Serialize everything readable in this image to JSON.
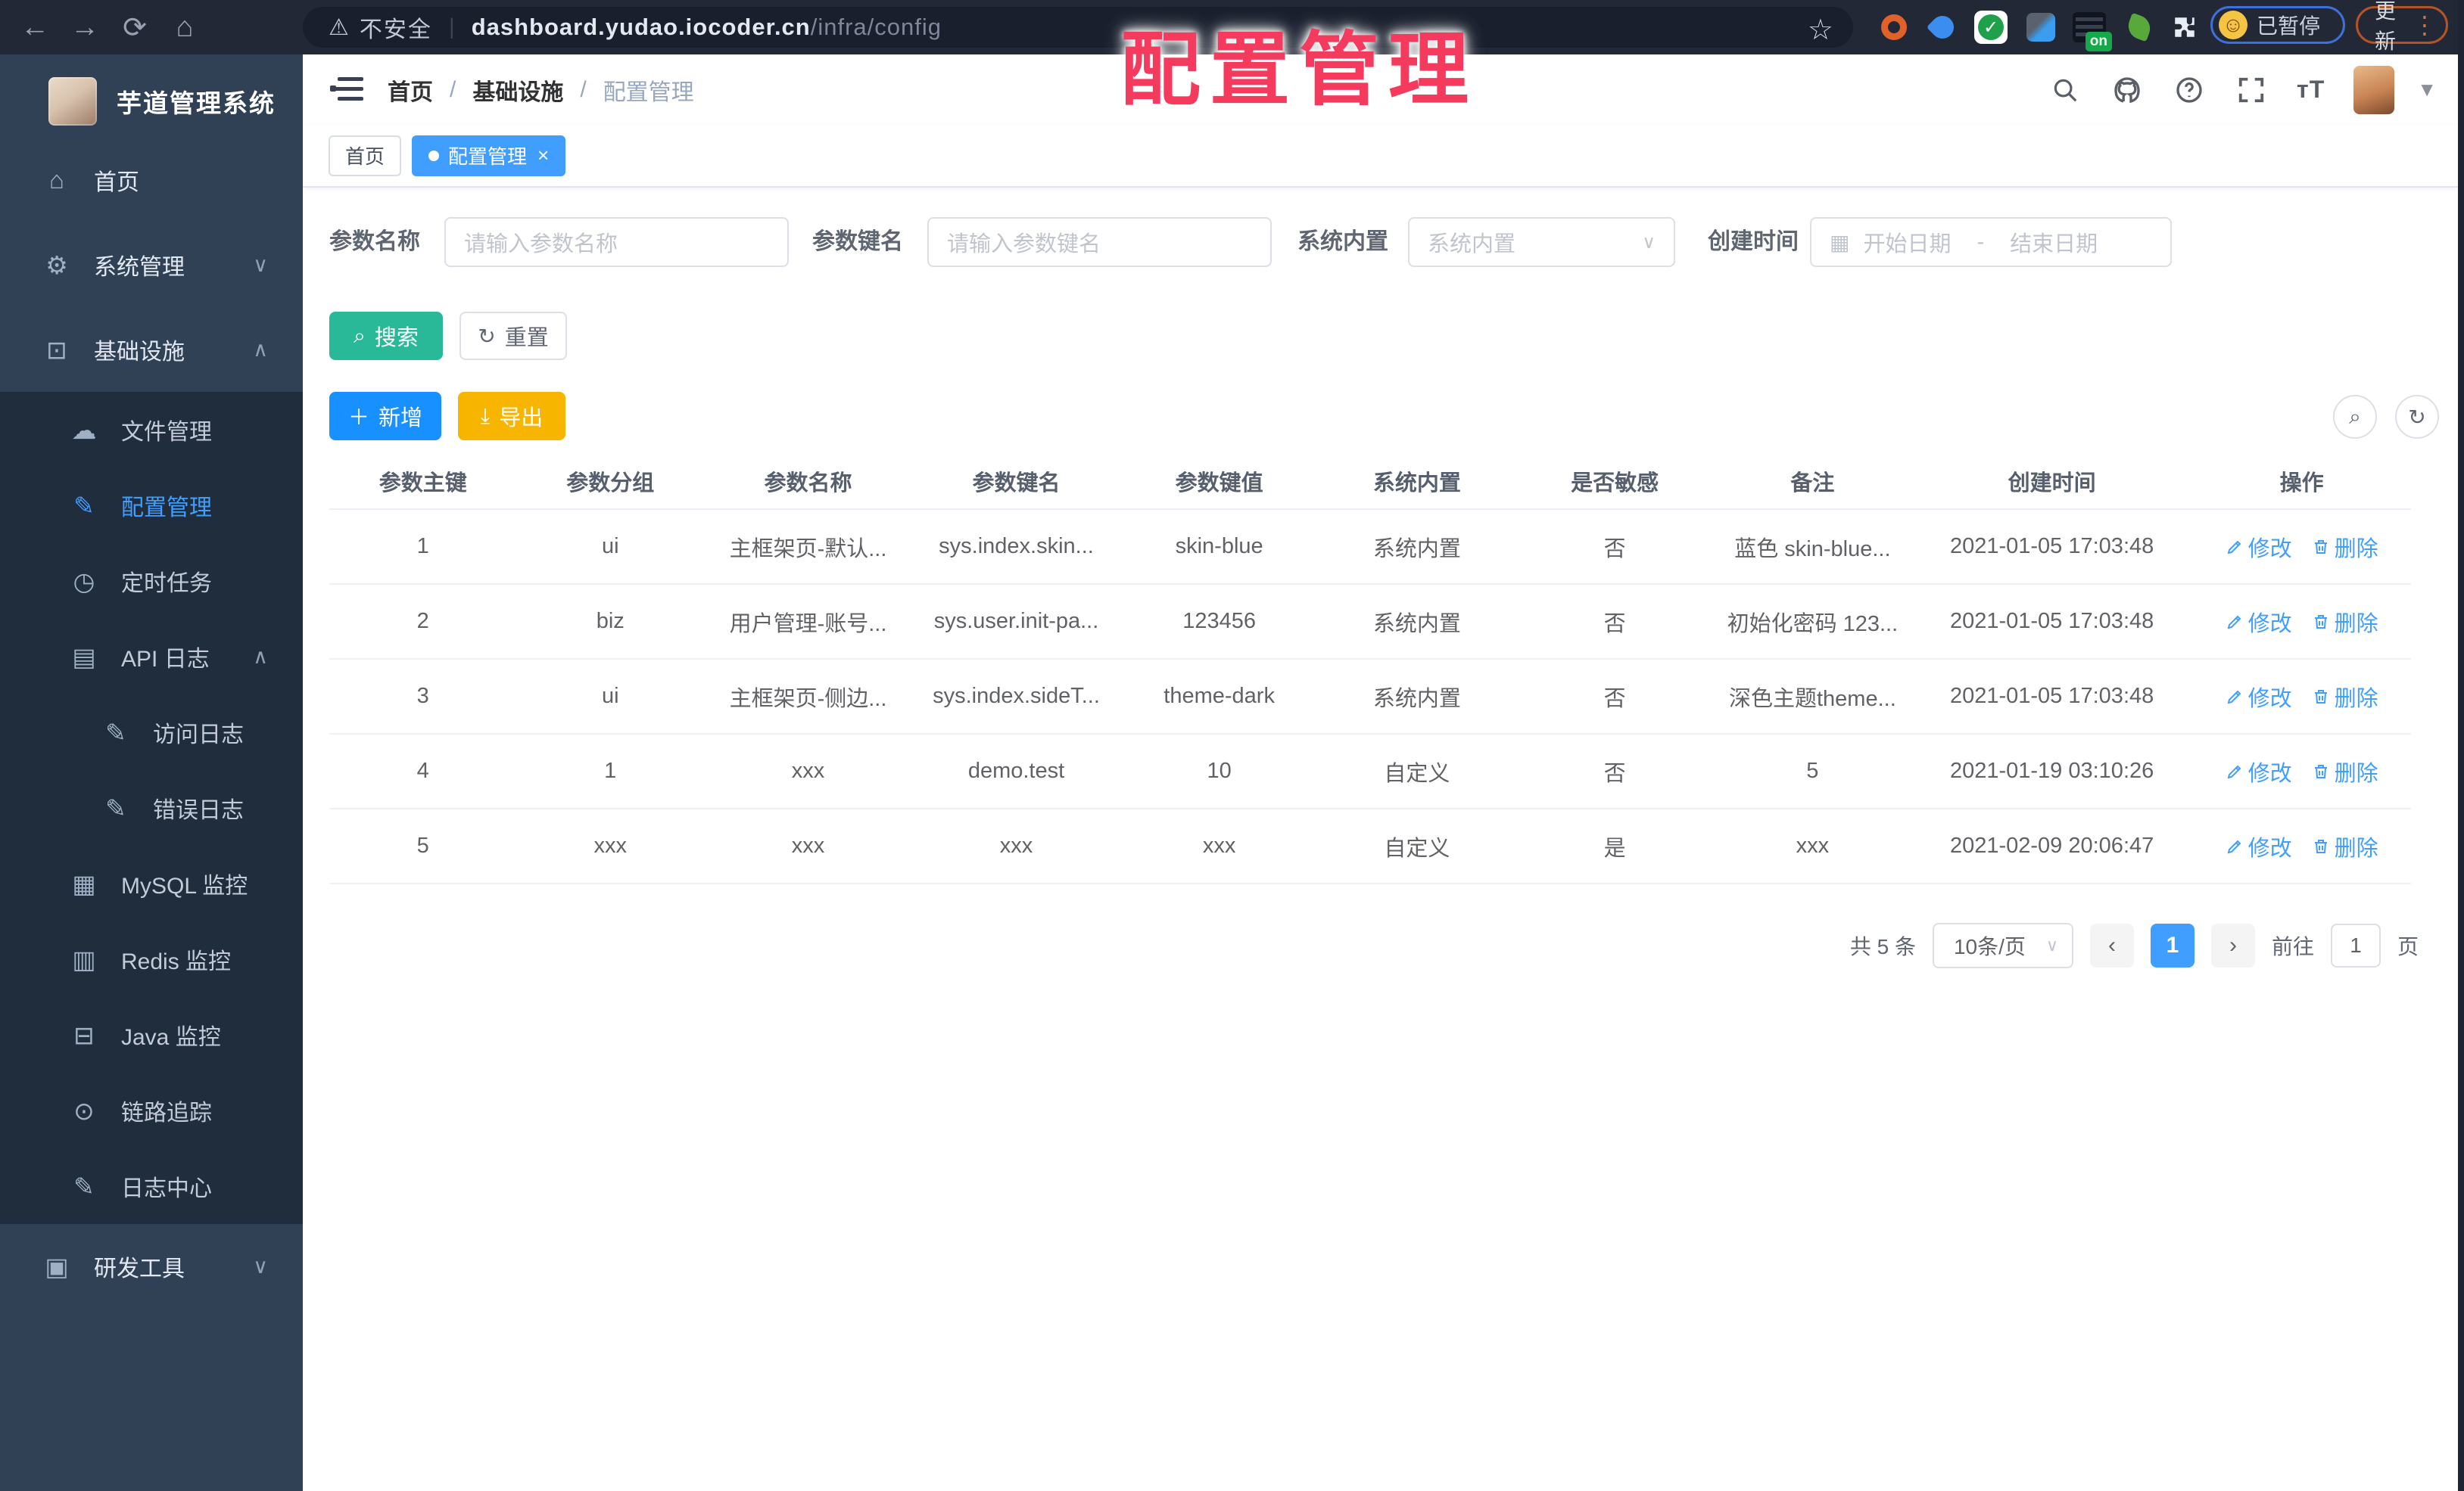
{
  "browser": {
    "security_label": "不安全",
    "url_host": "dashboard.yudao.iocoder.cn",
    "url_path": "/infra/config",
    "on_badge": "on",
    "paused_badge": "已暂停",
    "update_button": "更新"
  },
  "watermark": "配置管理",
  "sidebar": {
    "app_title": "芋道管理系统",
    "items": [
      {
        "id": "home",
        "label": "首页",
        "icon": "home-icon",
        "depth": 0
      },
      {
        "id": "system-mgmt",
        "label": "系统管理",
        "icon": "gear-icon",
        "depth": 0,
        "chevron": "down"
      },
      {
        "id": "infrastructure",
        "label": "基础设施",
        "icon": "infra-icon",
        "depth": 0,
        "chevron": "up"
      },
      {
        "id": "file-mgmt",
        "label": "文件管理",
        "icon": "cloud-upload-icon",
        "depth": 1
      },
      {
        "id": "config-mgmt",
        "label": "配置管理",
        "icon": "edit-square-icon",
        "depth": 1,
        "active": true
      },
      {
        "id": "scheduled-jobs",
        "label": "定时任务",
        "icon": "timer-icon",
        "depth": 1
      },
      {
        "id": "api-log",
        "label": "API 日志",
        "icon": "api-log-icon",
        "depth": 1,
        "chevron": "up"
      },
      {
        "id": "access-log",
        "label": "访问日志",
        "icon": "access-log-icon",
        "depth": 2
      },
      {
        "id": "error-log",
        "label": "错误日志",
        "icon": "error-log-icon",
        "depth": 2
      },
      {
        "id": "mysql-monitor",
        "label": "MySQL 监控",
        "icon": "mysql-icon",
        "depth": 1
      },
      {
        "id": "redis-monitor",
        "label": "Redis 监控",
        "icon": "redis-icon",
        "depth": 1
      },
      {
        "id": "java-monitor",
        "label": "Java 监控",
        "icon": "java-icon",
        "depth": 1
      },
      {
        "id": "trace",
        "label": "链路追踪",
        "icon": "eye-icon",
        "depth": 1
      },
      {
        "id": "log-center",
        "label": "日志中心",
        "icon": "log-center-icon",
        "depth": 1
      },
      {
        "id": "dev-tools",
        "label": "研发工具",
        "icon": "toolbox-icon",
        "depth": 0,
        "chevron": "down"
      }
    ]
  },
  "header": {
    "breadcrumb": [
      "首页",
      "基础设施",
      "配置管理"
    ]
  },
  "tabs": [
    {
      "label": "首页",
      "active": false
    },
    {
      "label": "配置管理",
      "active": true
    }
  ],
  "filters": {
    "name_label": "参数名称",
    "name_placeholder": "请输入参数名称",
    "key_label": "参数键名",
    "key_placeholder": "请输入参数键名",
    "type_label": "系统内置",
    "type_placeholder": "系统内置",
    "date_label": "创建时间",
    "date_start_placeholder": "开始日期",
    "date_separator": "-",
    "date_end_placeholder": "结束日期"
  },
  "toolbar": {
    "search_label": "搜索",
    "reset_label": "重置",
    "add_label": "新增",
    "export_label": "导出"
  },
  "table": {
    "columns": [
      "参数主键",
      "参数分组",
      "参数名称",
      "参数键名",
      "参数键值",
      "系统内置",
      "是否敏感",
      "备注",
      "创建时间",
      "操作"
    ],
    "rows": [
      [
        "1",
        "ui",
        "主框架页-默认...",
        "sys.index.skin...",
        "skin-blue",
        "系统内置",
        "否",
        "蓝色 skin-blue...",
        "2021-01-05 17:03:48"
      ],
      [
        "2",
        "biz",
        "用户管理-账号...",
        "sys.user.init-pa...",
        "123456",
        "系统内置",
        "否",
        "初始化密码 123...",
        "2021-01-05 17:03:48"
      ],
      [
        "3",
        "ui",
        "主框架页-侧边...",
        "sys.index.sideT...",
        "theme-dark",
        "系统内置",
        "否",
        "深色主题theme...",
        "2021-01-05 17:03:48"
      ],
      [
        "4",
        "1",
        "xxx",
        "demo.test",
        "10",
        "自定义",
        "否",
        "5",
        "2021-01-19 03:10:26"
      ],
      [
        "5",
        "xxx",
        "xxx",
        "xxx",
        "xxx",
        "自定义",
        "是",
        "xxx",
        "2021-02-09 20:06:47"
      ]
    ],
    "row_actions": [
      "修改",
      "删除"
    ]
  },
  "pagination": {
    "total_text": "共 5 条",
    "page_size": "10条/页",
    "current_page": "1",
    "goto_label": "前往",
    "goto_value": "1",
    "page_suffix": "页"
  },
  "colors": {
    "accent_blue": "#409eff",
    "search_teal": "#29b999",
    "add_blue": "#1890ff",
    "export_amber": "#f7b500",
    "watermark_red": "#f43b5e"
  }
}
